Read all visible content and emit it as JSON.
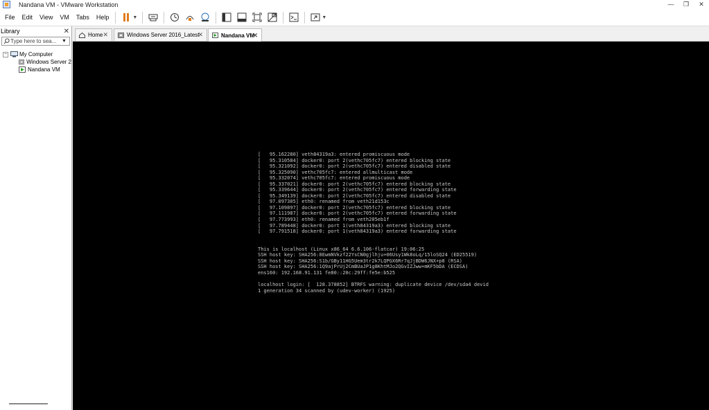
{
  "window": {
    "title": "Nandana VM - VMware Workstation",
    "controls": [
      "—",
      "❐",
      "✕"
    ]
  },
  "menu": {
    "items": [
      "File",
      "Edit",
      "View",
      "VM",
      "Tabs",
      "Help"
    ]
  },
  "toolbar": {
    "accent": "#e07b1a",
    "icons": [
      "pause-icon",
      "send-ctrl-alt-del-icon",
      "snapshot-icon",
      "revert-snapshot-icon",
      "snapshot-manager-icon",
      "show-library-icon",
      "thumbnail-bar-icon",
      "full-screen-icon",
      "unity-icon",
      "console-view-icon",
      "stretch-guest-icon"
    ]
  },
  "library": {
    "title": "Library",
    "close": "✕",
    "search_placeholder": "Type here to sea...",
    "tree": {
      "root": "My Computer",
      "expander": "−",
      "children": [
        "Windows Server 2",
        "Nandana VM"
      ]
    }
  },
  "tabs": [
    {
      "label": "Home",
      "close": "✕",
      "icon": "home-icon"
    },
    {
      "label": "Windows Server 2016_Latest",
      "close": "✕",
      "icon": "vm-icon"
    },
    {
      "label": "Nandana VM",
      "close": "✕",
      "icon": "vm-running-icon",
      "active": true
    }
  ],
  "console": {
    "lines": [
      "[   95.162280] veth84319a3: entered promiscuous mode",
      "[   95.310584] docker0: port 2(vethc705fc7) entered blocking state",
      "[   95.321092] docker0: port 2(vethc705fc7) entered disabled state",
      "[   95.325090] vethc705fc7: entered allmulticast mode",
      "[   95.332074] vethc705fc7: entered promiscuous mode",
      "[   95.337021] docker0: port 2(vethc705fc7) entered blocking state",
      "[   95.339644] docker0: port 2(vethc705fc7) entered forwarding state",
      "[   95.349139] docker0: port 2(vethc705fc7) entered disabled state",
      "[   97.097305] eth0: renamed from veth21d153c",
      "[   97.109897] docker0: port 2(vethc705fc7) entered blocking state",
      "[   97.111987] docker0: port 2(vethc705fc7) entered forwarding state",
      "[   97.773993] eth0: renamed from veth205eb1f",
      "[   97.789448] docker0: port 1(veth84319a3) entered blocking state",
      "[   97.791518] docker0: port 1(veth84319a3) entered forwarding state",
      "",
      "",
      "This is localhost (Linux x86_64 6.6.106-flatcar) 19:06:25",
      "SSH host key: SHA256:8EwmNVkzf22YsCN0gjlhju+06Usy1Wk8oLq/15loSQ24 (ED25519)",
      "SSH host key: SHA256:S1b/GBy11HG5Uem3tr2k7LQPGX6Rr7qJjBDW6JNX+p8 (RSA)",
      "SSH host key: SHA256:1Q9ajPrUj2CmBUaJP1g8KhtMJo2QGvIZJww+mKF5bDA (ECDSA)",
      "ens160: 192.168.91.131 fe80::20c:29ff:fe5e:b525",
      "",
      "localhost login: [  128.378852] BTRFS warning: duplicate device /dev/sda4 devid",
      "1 generation 34 scanned by (udev-worker) (1925)"
    ]
  }
}
